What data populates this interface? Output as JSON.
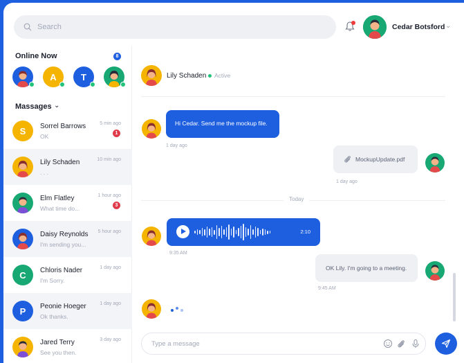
{
  "search": {
    "placeholder": "Search"
  },
  "user": {
    "name": "Cedar Botsford",
    "avatar_color": "#18a874"
  },
  "online": {
    "title": "Online Now",
    "count": "8",
    "users": [
      {
        "type": "photo",
        "color": "#1e5fe0"
      },
      {
        "type": "letter",
        "letter": "A",
        "color": "#f4b400"
      },
      {
        "type": "letter",
        "letter": "T",
        "color": "#1e5fe0"
      },
      {
        "type": "photo",
        "color": "#18a874"
      }
    ]
  },
  "messages_section": {
    "title": "Massages"
  },
  "conversations": [
    {
      "name": "Sorrel Barrows",
      "preview": "OK",
      "time": "5 min ago",
      "badge": "1",
      "avatar": {
        "type": "letter",
        "letter": "S",
        "color": "#f4b400"
      }
    },
    {
      "name": "Lily Schaden",
      "preview": ". . .",
      "time": "10 min ago",
      "badge": "",
      "active": true,
      "avatar": {
        "type": "photo",
        "color": "#f4b400"
      }
    },
    {
      "name": "Elm Flatley",
      "preview": "What time do...",
      "time": "1 hour ago",
      "badge": "3",
      "avatar": {
        "type": "photo",
        "color": "#18a874"
      }
    },
    {
      "name": "Daisy Reynolds",
      "preview": "I'm sending you...",
      "time": "5 hour ago",
      "badge": "",
      "active": true,
      "avatar": {
        "type": "photo",
        "color": "#1e5fe0"
      }
    },
    {
      "name": "Chloris Nader",
      "preview": "I'm Sorry.",
      "time": "1 day ago",
      "badge": "",
      "avatar": {
        "type": "letter",
        "letter": "C",
        "color": "#18a874"
      }
    },
    {
      "name": "Peonie Hoeger",
      "preview": "Ok thanks.",
      "time": "1 day ago",
      "badge": "",
      "active": true,
      "avatar": {
        "type": "letter",
        "letter": "P",
        "color": "#1e5fe0"
      }
    },
    {
      "name": "Jared Terry",
      "preview": "See you then.",
      "time": "3 day ago",
      "badge": "",
      "avatar": {
        "type": "photo",
        "color": "#f4b400"
      }
    }
  ],
  "chat": {
    "contact_name": "Lily Schaden",
    "status": "Active",
    "msg1": {
      "text": "Hi Cedar. Send me the mockup file.",
      "time": "1 day ago"
    },
    "msg2": {
      "file_name": "MockupUpdate.pdf",
      "time": "1 day ago"
    },
    "divider": "Today",
    "msg3": {
      "duration": "2:10",
      "time": "9:35 AM"
    },
    "msg4": {
      "text": "OK Lily. I'm going to a meeting.",
      "time": "9:45 AM"
    },
    "composer_placeholder": "Type a message"
  },
  "icons": {
    "search": "search-icon",
    "bell": "bell-icon",
    "chevron": "chevron-down-icon",
    "attachment": "paperclip-icon",
    "emoji": "emoji-icon",
    "microphone": "microphone-icon",
    "send": "send-icon",
    "play": "play-icon"
  },
  "colors": {
    "accent": "#1e5fe0",
    "online": "#20c37a",
    "badge": "#e03b4b"
  }
}
